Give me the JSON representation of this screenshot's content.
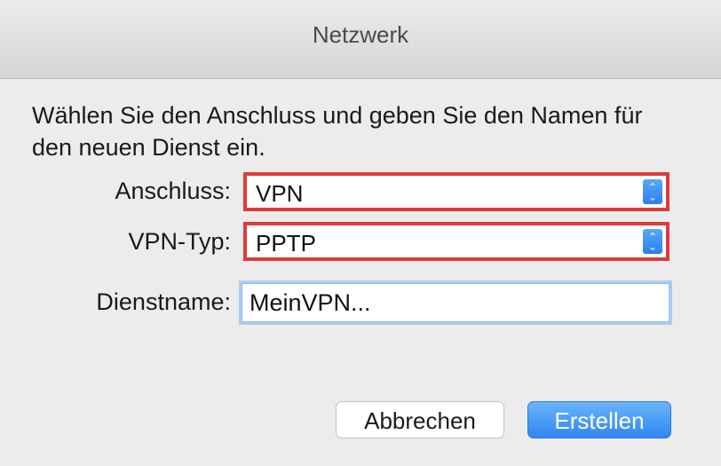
{
  "window": {
    "title": "Netzwerk"
  },
  "instruction": "Wählen Sie den Anschluss und geben Sie den Namen für den neuen Dienst ein.",
  "form": {
    "anschluss_label": "Anschluss:",
    "anschluss_value": "VPN",
    "vpn_typ_label": "VPN-Typ:",
    "vpn_typ_value": "PPTP",
    "dienstname_label": "Dienstname:",
    "dienstname_value": "MeinVPN..."
  },
  "buttons": {
    "cancel_label": "Abbrechen",
    "create_label": "Erstellen"
  },
  "colors": {
    "highlight": "#e03a3a",
    "accent": "#2f86f1"
  },
  "icons": {
    "popup_arrows": "up-down-chevron-icon"
  }
}
